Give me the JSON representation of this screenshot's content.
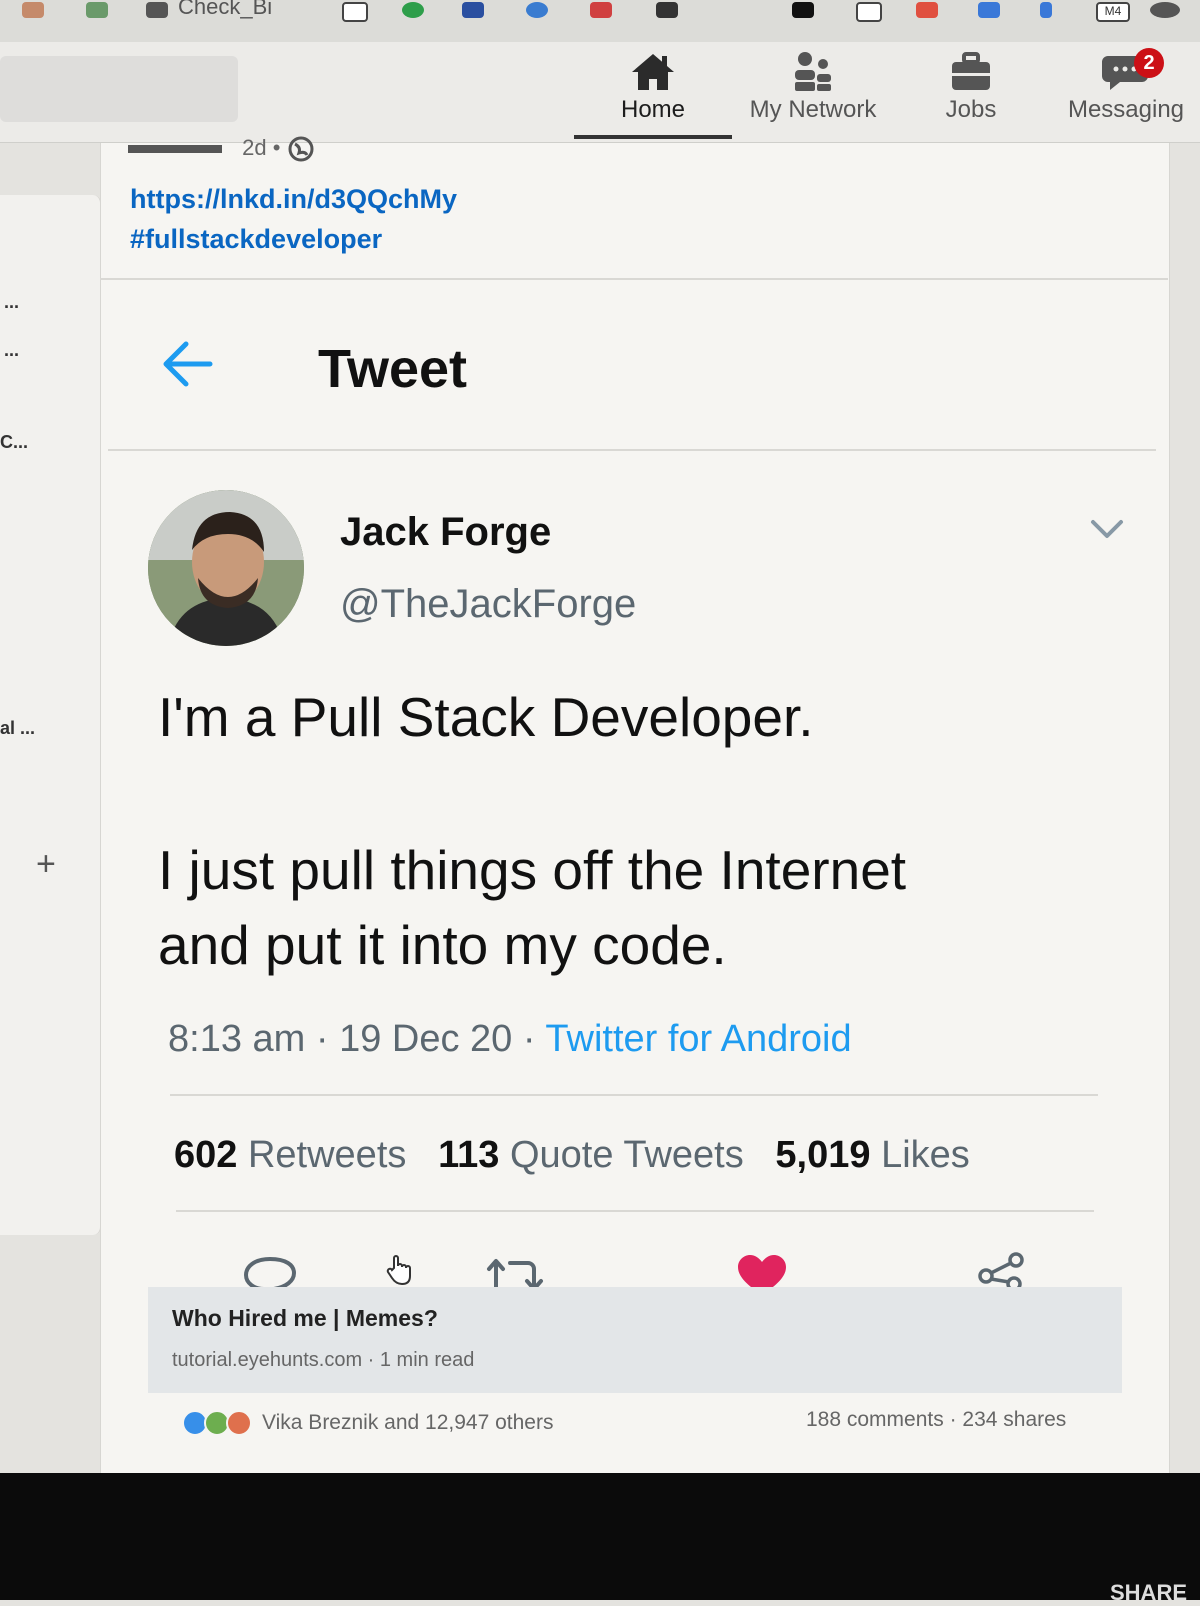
{
  "browser": {
    "bookmark_text": "Check_Bi",
    "bookmark_badge": "M4"
  },
  "nav": {
    "items": [
      {
        "label": "Home",
        "icon": "home-icon"
      },
      {
        "label": "My Network",
        "icon": "network-icon"
      },
      {
        "label": "Jobs",
        "icon": "briefcase-icon"
      },
      {
        "label": "Messaging",
        "icon": "messaging-icon"
      }
    ],
    "messaging_badge": "2"
  },
  "sidebar": {
    "truncated": [
      "...",
      "...",
      "C...",
      "al ..."
    ],
    "add": "+"
  },
  "post": {
    "time": "2d •",
    "link": "https://lnkd.in/d3QQchMy",
    "hashtag": "#fullstackdeveloper"
  },
  "tweet": {
    "header": "Tweet",
    "author_name": "Jack Forge",
    "author_handle": "@TheJackForge",
    "line1": "I'm a Pull Stack Developer.",
    "line2": "I just pull things off the Internet",
    "line3": "and put it into my code.",
    "time": "8:13 am · 19 Dec 20 · ",
    "source": "Twitter for Android",
    "retweets": "602",
    "retweets_label": "Retweets",
    "quote_tweets": "113",
    "quote_tweets_label": "Quote Tweets",
    "likes": "5,019",
    "likes_label": "Likes"
  },
  "article": {
    "title": "Who Hired me | Memes?",
    "source": "tutorial.eyehunts.com · 1 min read"
  },
  "social": {
    "reactions_text": "Vika Breznik and 12,947 others",
    "counts": "188 comments · 234 shares"
  },
  "colors": {
    "linkedin_blue": "#0a66c2",
    "twitter_blue": "#1d9bf0",
    "like_red": "#e0245e",
    "badge_red": "#cc1016"
  },
  "footer": {
    "share": "SHARE"
  }
}
